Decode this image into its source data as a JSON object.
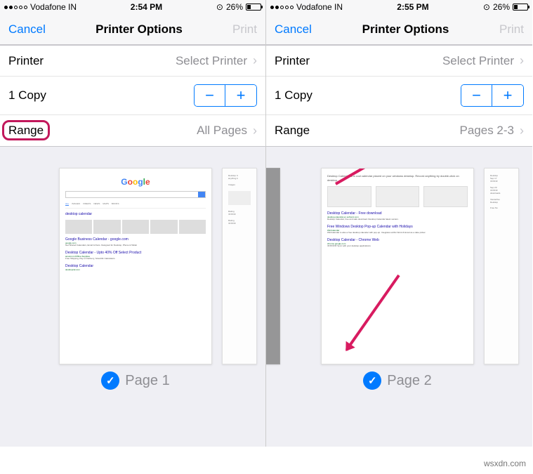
{
  "watermark": "wsxdn.com",
  "left": {
    "status": {
      "carrier": "Vodafone IN",
      "time": "2:54 PM",
      "battery": "26%"
    },
    "nav": {
      "cancel": "Cancel",
      "title": "Printer Options",
      "print": "Print"
    },
    "printer_label": "Printer",
    "printer_value": "Select Printer",
    "copies": "1 Copy",
    "range_label": "Range",
    "range_value": "All Pages",
    "page1_label": "Page 1"
  },
  "right": {
    "status": {
      "carrier": "Vodafone IN",
      "time": "2:55 PM",
      "battery": "26%"
    },
    "nav": {
      "cancel": "Cancel",
      "title": "Printer Options",
      "print": "Print"
    },
    "printer_label": "Printer",
    "printer_value": "Select Printer",
    "copies": "1 Copy",
    "range_label": "Range",
    "range_value": "Pages 2-3",
    "page2_label": "Page 2"
  }
}
